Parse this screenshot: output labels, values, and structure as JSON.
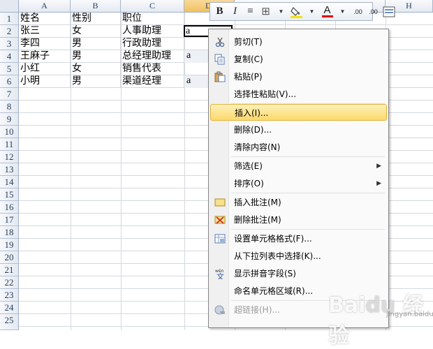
{
  "columns": [
    "A",
    "B",
    "C",
    "D",
    "H"
  ],
  "row_numbers": [
    "1",
    "2",
    "3",
    "4",
    "5",
    "6",
    "7",
    "8",
    "9",
    "10",
    "11",
    "12",
    "13",
    "14",
    "15",
    "16",
    "17",
    "18",
    "19",
    "20",
    "21",
    "22",
    "23",
    "24",
    "25"
  ],
  "rows": [
    [
      "姓名",
      "性别",
      "职位"
    ],
    [
      "张三",
      "女",
      "人事助理"
    ],
    [
      "李四",
      "男",
      "行政助理"
    ],
    [
      "王麻子",
      "男",
      "总经理助理"
    ],
    [
      "小红",
      "女",
      "销售代表"
    ],
    [
      "小明",
      "男",
      "渠道经理"
    ]
  ],
  "d_cells": {
    "d2": "a",
    "d4": "a",
    "d6": "a"
  },
  "mini_toolbar": {
    "bold": "B",
    "italic": "I",
    "align": "≡",
    "borders": "⊞",
    "fill_color": "#f5e300",
    "font_color": "#e00000",
    "font_letter": "A",
    "increase_decimal": ".00",
    "decrease_decimal": ".00"
  },
  "context_menu": {
    "cut": "剪切(T)",
    "copy": "复制(C)",
    "paste": "粘贴(P)",
    "paste_special": "选择性粘贴(V)...",
    "insert": "插入(I)...",
    "delete": "删除(D)...",
    "clear_contents": "清除内容(N)",
    "filter": "筛选(E)",
    "sort": "排序(O)",
    "insert_comment": "插入批注(M)",
    "delete_comment": "删除批注(M)",
    "format_cells": "设置单元格格式(F)...",
    "pick_from_list": "从下拉列表中选择(K)...",
    "show_phonetic": "显示拼音字段(S)",
    "define_name": "命名单元格区域(R)...",
    "hyperlink": "超链接(H)..."
  },
  "watermark": {
    "text": "Baidu 经验",
    "sub": "jingyan.baidu.com"
  },
  "colors": {
    "highlight": "#fbd96a",
    "grid": "#d4d8de",
    "header_active": "#f1c15f"
  }
}
